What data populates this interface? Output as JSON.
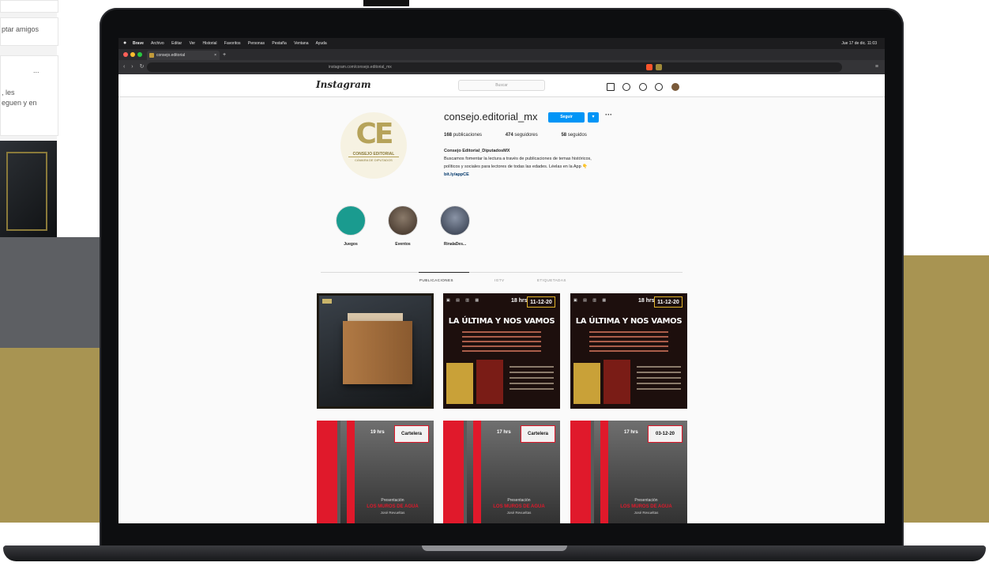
{
  "background": {
    "left_snippet_1": "ptar amigos",
    "left_snippet_2": "...",
    "left_snippet_3": ", les",
    "left_snippet_4": "eguen y en"
  },
  "browser": {
    "menubar_apple": "●",
    "menubar_items": [
      "Brave",
      "Archivo",
      "Editar",
      "Ver",
      "Historial",
      "Favoritos",
      "Personas",
      "Pestaña",
      "Ventana",
      "Ayuda"
    ],
    "menubar_status": "Jue 17 de dic. 11:03",
    "tab_title": "consejo.editorial",
    "tab_close": "×",
    "new_tab": "+",
    "nav_back": "‹",
    "nav_forward": "›",
    "nav_reload": "↻",
    "url": "instagram.com/consejo.editorial_mx",
    "menu_icon": "≡"
  },
  "instagram": {
    "logo": "Instagram",
    "search_placeholder": "Buscar",
    "nav_icons": [
      "home-icon",
      "messenger-icon",
      "explore-icon",
      "heart-icon",
      "avatar"
    ],
    "profile": {
      "avatar_text": "CE",
      "avatar_line1": "CONSEJO EDITORIAL",
      "avatar_line2": "CÁMARA DE DIPUTADOS",
      "username": "consejo.editorial_mx",
      "follow_label": "Seguir",
      "dropdown_label": "▾",
      "more_label": "···",
      "stats": [
        {
          "value": "168",
          "label": "publicaciones"
        },
        {
          "value": "474",
          "label": "seguidores"
        },
        {
          "value": "58",
          "label": "seguidos"
        }
      ],
      "bio_name": "Consejo Editorial_DiputadosMX",
      "bio_line1": "Buscamos fomentar la lectura a través de publicaciones de temas históricos,",
      "bio_line2": "políticos y sociales para lectores de todas las edades. Léelas en la App 👇",
      "bio_link": "bit.ly/appCE"
    },
    "highlights": [
      {
        "label": "Juegos",
        "color": "#1a9b8f"
      },
      {
        "label": "Eventos",
        "color": "#5a4636"
      },
      {
        "label": "RinalaDes...",
        "color": "#3d4a5c"
      }
    ],
    "tabs": [
      {
        "label": "PUBLICACIONES",
        "active": true
      },
      {
        "label": "IGTV",
        "active": false
      },
      {
        "label": "ETIQUETADAS",
        "active": false
      }
    ],
    "posts": [
      {
        "kind": "photo",
        "accent": "#c9b46a"
      },
      {
        "kind": "event",
        "time": "18 hrs",
        "date": "11-12-20",
        "title": "LA ÚLTIMA Y NOS VAMOS"
      },
      {
        "kind": "event",
        "time": "18 hrs",
        "date": "11-12-20",
        "title": "LA ÚLTIMA Y NOS VAMOS"
      },
      {
        "kind": "presentation",
        "time": "19 hrs",
        "date": "Cartelera",
        "pres": "Presentación",
        "book": "LOS MUROS DE AGUA",
        "author": "José Revueltas"
      },
      {
        "kind": "presentation",
        "time": "17 hrs",
        "date": "Cartelera",
        "pres": "Presentación",
        "book": "LOS MUROS DE AGUA",
        "author": "José Revueltas"
      },
      {
        "kind": "presentation",
        "time": "17 hrs",
        "date": "03-12-20",
        "pres": "Presentación",
        "book": "LOS MUROS DE AGUA",
        "author": "José Revueltas"
      }
    ]
  }
}
